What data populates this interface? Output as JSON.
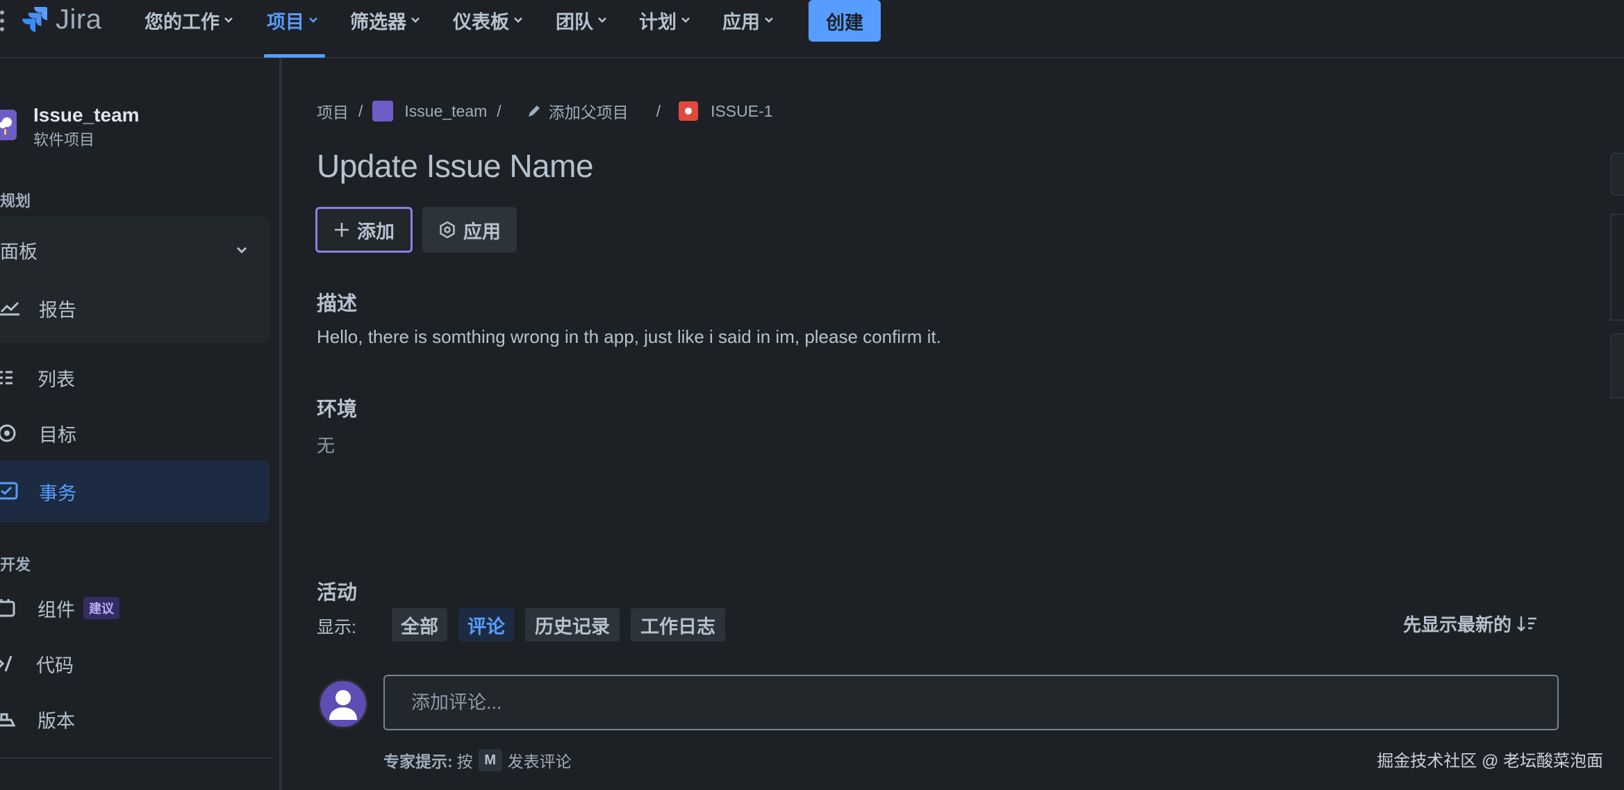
{
  "app": {
    "logo_text": "Jira"
  },
  "topnav": {
    "items": [
      {
        "label": "您的工作"
      },
      {
        "label": "项目"
      },
      {
        "label": "筛选器"
      },
      {
        "label": "仪表板"
      },
      {
        "label": "团队"
      },
      {
        "label": "计划"
      },
      {
        "label": "应用"
      }
    ],
    "create_label": "创建"
  },
  "sidebar": {
    "project_name": "Issue_team",
    "project_type": "软件项目",
    "section_planning": "规划",
    "board_label": "面板",
    "reports_label": "报告",
    "list_label": "列表",
    "goals_label": "目标",
    "issues_label": "事务",
    "section_dev": "开发",
    "components_label": "组件",
    "components_badge": "建议",
    "code_label": "代码",
    "releases_label": "版本"
  },
  "breadcrumb": {
    "projects": "项目",
    "project": "Issue_team",
    "add_parent": "添加父项目",
    "issue_key": "ISSUE-1"
  },
  "issue": {
    "title": "Update Issue Name",
    "add_button": "添加",
    "apps_button": "应用",
    "description_label": "描述",
    "description": "Hello, there is somthing wrong in th app, just like i said in im, please confirm it.",
    "environment_label": "环境",
    "environment": "无"
  },
  "activity": {
    "label": "活动",
    "show_label": "显示:",
    "filters": [
      "全部",
      "评论",
      "历史记录",
      "工作日志"
    ],
    "sort_label": "先显示最新的",
    "comment_placeholder": "添加评论...",
    "tip_prefix": "专家提示:",
    "tip_press": "按",
    "tip_key": "M",
    "tip_suffix": "发表评论"
  },
  "watermark": "掘金技术社区 @ 老坛酸菜泡面",
  "colors": {
    "accent": "#579dff",
    "background": "#1d2125",
    "focus_border": "#8f7ee7"
  }
}
